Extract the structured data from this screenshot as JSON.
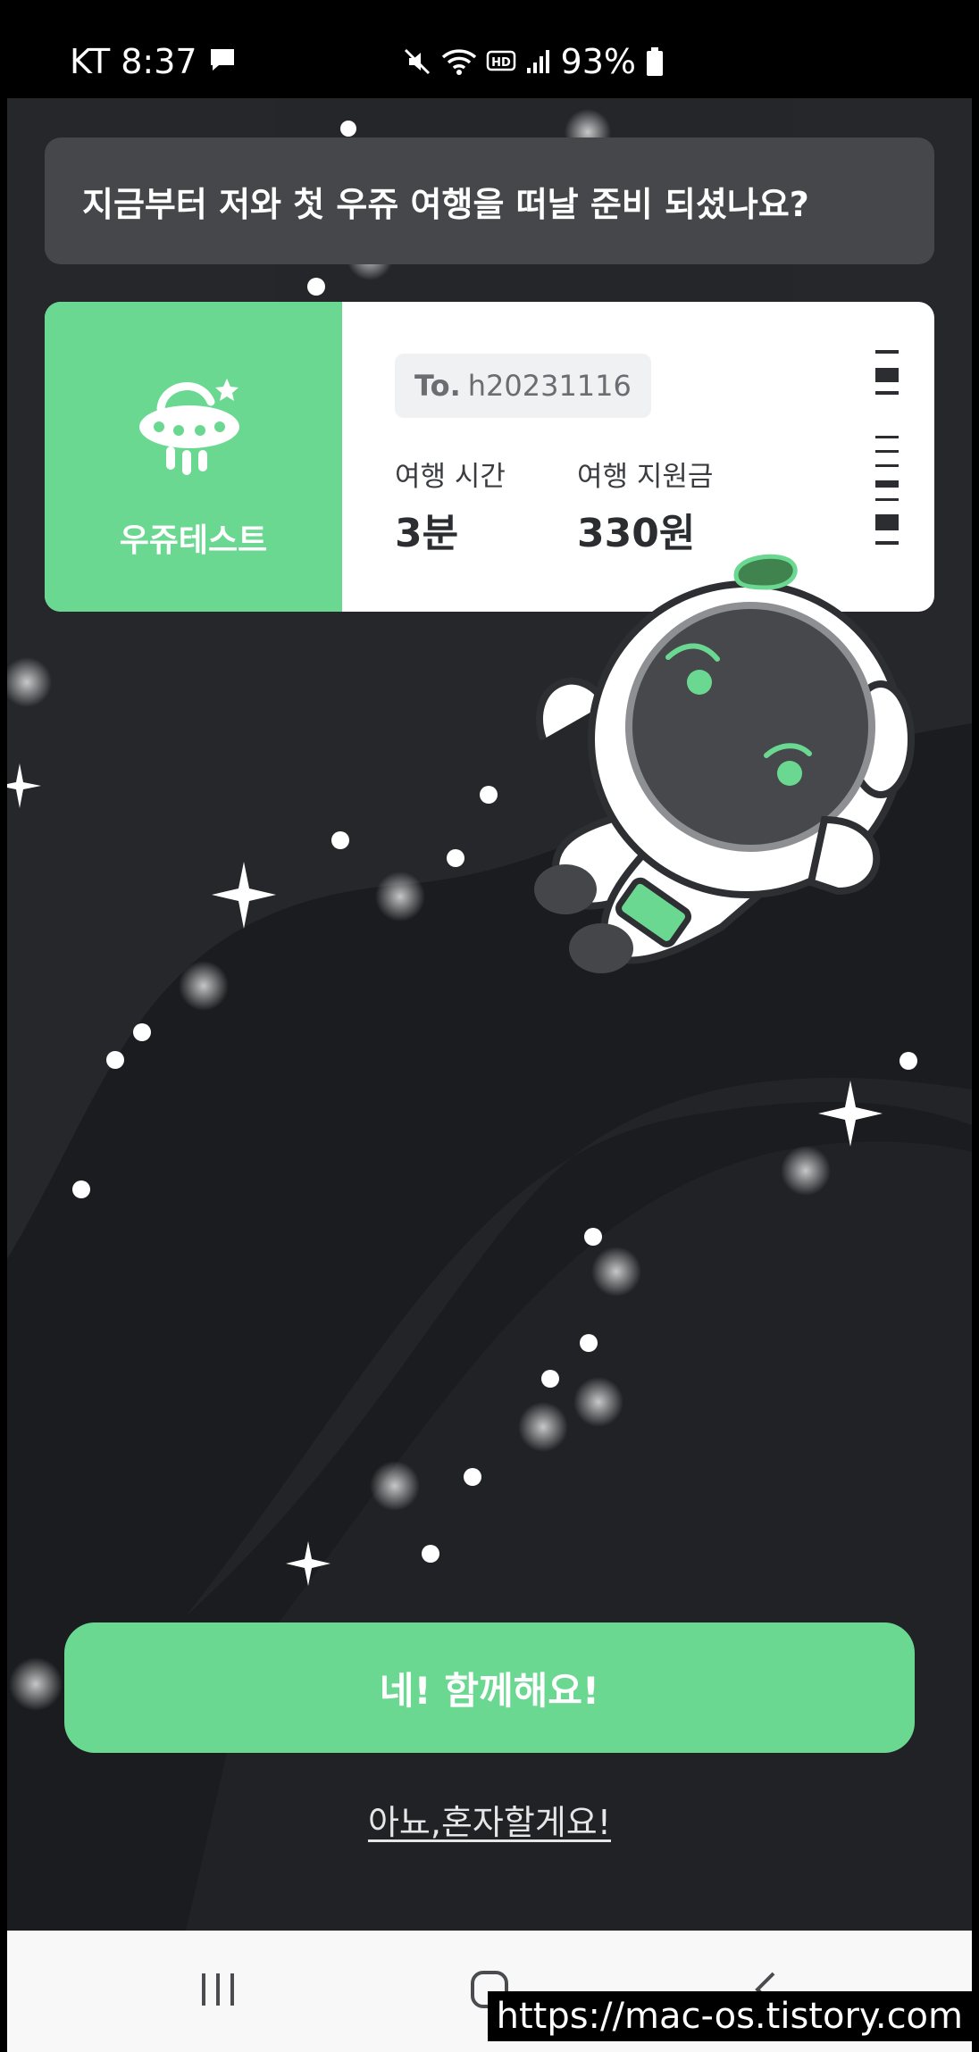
{
  "status_bar": {
    "carrier_time": "KT 8:37",
    "battery": "93%",
    "icons": [
      "message-icon",
      "mute-icon",
      "wifi-icon",
      "hd-icon",
      "signal-icon",
      "battery-icon"
    ]
  },
  "question": "지금부터 저와 첫 우쥬 여행을 떠날 준비 되셨나요?",
  "ticket": {
    "brand": "우쥬테스트",
    "to_prefix": "To.",
    "to_value": "h20231116",
    "travel_time_label": "여행 시간",
    "travel_time_value": "3분",
    "support_label": "여행 지원금",
    "support_value": "330원"
  },
  "actions": {
    "primary": "네! 함께해요!",
    "secondary": "아뇨,혼자할게요!"
  },
  "nav": [
    "recent-apps-icon",
    "home-icon",
    "back-icon"
  ],
  "watermark": "https://mac-os.tistory.com",
  "colors": {
    "accent": "#6bd892",
    "background": "#1a1c1f",
    "question_box": "#46474a"
  }
}
